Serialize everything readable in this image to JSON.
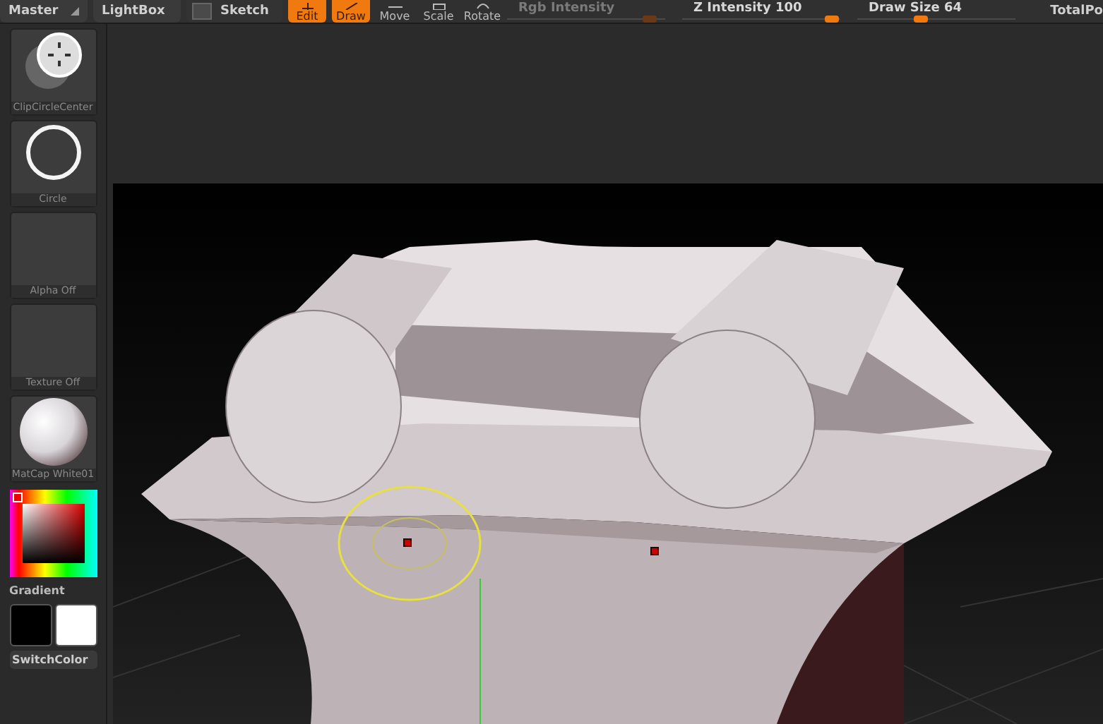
{
  "toolbar": {
    "menus": [
      {
        "label": "Master",
        "kind": "dropdown"
      },
      {
        "label": "LightBox",
        "kind": "plain"
      }
    ],
    "sketch": {
      "label": "Sketch",
      "checked": false
    },
    "tools": [
      {
        "label": "Edit",
        "selected": true,
        "kind": "edit"
      },
      {
        "label": "Draw",
        "selected": true,
        "kind": "draw"
      },
      {
        "label": "Move",
        "selected": false,
        "kind": "move"
      },
      {
        "label": "Scale",
        "selected": false,
        "kind": "scale"
      },
      {
        "label": "Rotate",
        "selected": false,
        "kind": "rotate"
      }
    ],
    "sliders": [
      {
        "label": "Rgb Intensity",
        "disabled": true,
        "level": 0.9
      },
      {
        "label": "Z Intensity",
        "value": "100",
        "disabled": false,
        "level": 0.95
      },
      {
        "label": "Draw Size",
        "value": "64",
        "disabled": false,
        "level": 0.4
      }
    ],
    "total": "TotalPo"
  },
  "palette": [
    {
      "label": "ClipCircleCenter",
      "kind": "brush"
    },
    {
      "label": "Circle",
      "kind": "stroke"
    },
    {
      "label": "Alpha Off",
      "kind": "empty"
    },
    {
      "label": "Texture Off",
      "kind": "empty"
    },
    {
      "label": "MatCap White01",
      "kind": "material"
    }
  ],
  "color_picker": {
    "label": "Gradient"
  },
  "swatches": [
    {
      "color": "#000000"
    },
    {
      "color": "#ffffff"
    }
  ],
  "switch_label": "SwitchColor"
}
